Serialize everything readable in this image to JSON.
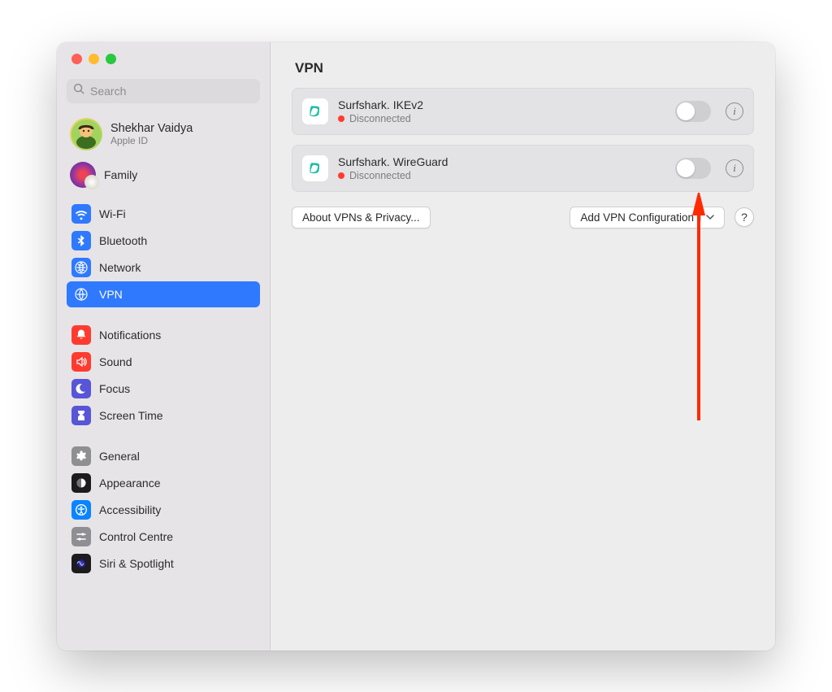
{
  "search": {
    "placeholder": "Search"
  },
  "account": {
    "name": "Shekhar Vaidya",
    "sub": "Apple ID"
  },
  "family": {
    "label": "Family"
  },
  "sidebar": {
    "group1": [
      {
        "label": "Wi-Fi",
        "icon": "wifi",
        "color": "#2f79ff"
      },
      {
        "label": "Bluetooth",
        "icon": "bluetooth",
        "color": "#2f79ff"
      },
      {
        "label": "Network",
        "icon": "network",
        "color": "#2f79ff"
      },
      {
        "label": "VPN",
        "icon": "vpn",
        "color": "#2f79ff",
        "selected": true
      }
    ],
    "group2": [
      {
        "label": "Notifications",
        "icon": "bell",
        "color": "#ff3b30"
      },
      {
        "label": "Sound",
        "icon": "sound",
        "color": "#ff3b30"
      },
      {
        "label": "Focus",
        "icon": "moon",
        "color": "#5856d6"
      },
      {
        "label": "Screen Time",
        "icon": "hourglass",
        "color": "#5856d6"
      }
    ],
    "group3": [
      {
        "label": "General",
        "icon": "gear",
        "color": "#8e8e93"
      },
      {
        "label": "Appearance",
        "icon": "appearance",
        "color": "#1c1c1e"
      },
      {
        "label": "Accessibility",
        "icon": "accessibility",
        "color": "#0a84ff"
      },
      {
        "label": "Control Centre",
        "icon": "controls",
        "color": "#8e8e93"
      },
      {
        "label": "Siri & Spotlight",
        "icon": "siri",
        "color": "#1c1c1e"
      }
    ]
  },
  "main": {
    "title": "VPN",
    "vpns": [
      {
        "name": "Surfshark. IKEv2",
        "status": "Disconnected",
        "status_color": "red"
      },
      {
        "name": "Surfshark. WireGuard",
        "status": "Disconnected",
        "status_color": "red"
      }
    ],
    "about": "About VPNs & Privacy...",
    "add": "Add VPN Configuration",
    "help": "?"
  }
}
